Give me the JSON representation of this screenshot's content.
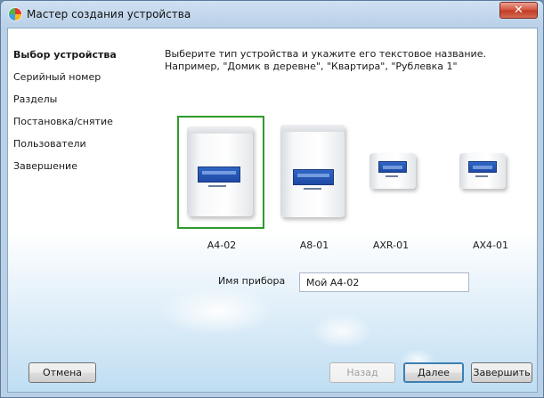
{
  "window": {
    "title": "Мастер создания устройства",
    "close_glyph": "✕"
  },
  "sidebar": {
    "items": [
      {
        "label": "Выбор устройства",
        "active": true
      },
      {
        "label": "Серийный номер",
        "active": false
      },
      {
        "label": "Разделы",
        "active": false
      },
      {
        "label": "Постановка/снятие",
        "active": false
      },
      {
        "label": "Пользователи",
        "active": false
      },
      {
        "label": "Завершение",
        "active": false
      }
    ]
  },
  "main": {
    "instruction": "Выберите тип устройства и укажите его текстовое название. Например, \"Домик в деревне\", \"Квартира\", \"Рублевка 1\"",
    "devices": [
      {
        "label": "A4-02",
        "selected": true
      },
      {
        "label": "A8-01",
        "selected": false
      },
      {
        "label": "AXR-01",
        "selected": false
      },
      {
        "label": "AX4-01",
        "selected": false
      }
    ],
    "name_field": {
      "label": "Имя прибора",
      "value": "Мой A4-02"
    }
  },
  "buttons": {
    "cancel": "Отмена",
    "back": "Назад",
    "next": "Далее",
    "finish": "Завершить"
  },
  "colors": {
    "selection_border": "#2f9a2a",
    "title_bar": "#b9d0e7",
    "device_screen": "#2f66c4"
  }
}
